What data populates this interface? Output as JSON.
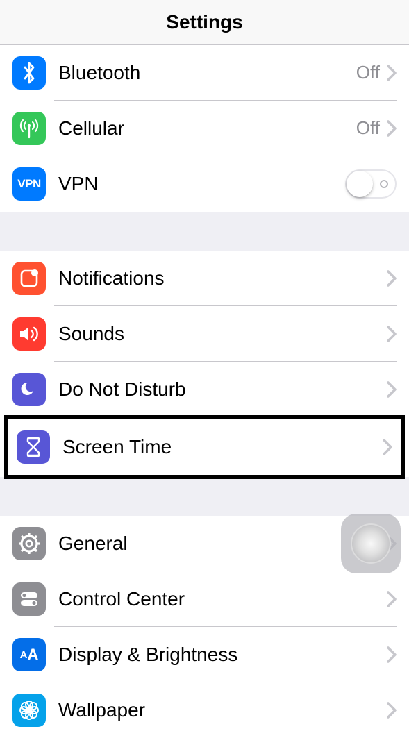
{
  "header": {
    "title": "Settings"
  },
  "sections": [
    {
      "rows": [
        {
          "key": "bluetooth",
          "label": "Bluetooth",
          "value": "Off",
          "has_chevron": true,
          "icon": "bluetooth",
          "icon_bg": "#007aff"
        },
        {
          "key": "cellular",
          "label": "Cellular",
          "value": "Off",
          "has_chevron": true,
          "icon": "cellular",
          "icon_bg": "#34c759"
        },
        {
          "key": "vpn",
          "label": "VPN",
          "toggle": false,
          "icon": "vpn",
          "icon_bg": "#007aff"
        }
      ]
    },
    {
      "rows": [
        {
          "key": "notifications",
          "label": "Notifications",
          "has_chevron": true,
          "icon": "notifications",
          "icon_bg": "#ff5130"
        },
        {
          "key": "sounds",
          "label": "Sounds",
          "has_chevron": true,
          "icon": "sounds",
          "icon_bg": "#ff3b30"
        },
        {
          "key": "dnd",
          "label": "Do Not Disturb",
          "has_chevron": true,
          "icon": "moon",
          "icon_bg": "#5856d6"
        },
        {
          "key": "screentime",
          "label": "Screen Time",
          "has_chevron": true,
          "icon": "hourglass",
          "icon_bg": "#5856d6",
          "highlighted": true
        }
      ]
    },
    {
      "rows": [
        {
          "key": "general",
          "label": "General",
          "has_chevron": true,
          "icon": "gear",
          "icon_bg": "#8e8e93",
          "assistive_touch_overlay": true
        },
        {
          "key": "controlcenter",
          "label": "Control Center",
          "has_chevron": true,
          "icon": "switches",
          "icon_bg": "#8e8e93"
        },
        {
          "key": "display",
          "label": "Display & Brightness",
          "has_chevron": true,
          "icon": "aa",
          "icon_bg": "#046ee8"
        },
        {
          "key": "wallpaper",
          "label": "Wallpaper",
          "has_chevron": true,
          "icon": "flower",
          "icon_bg": "#05a2ea"
        }
      ]
    }
  ]
}
